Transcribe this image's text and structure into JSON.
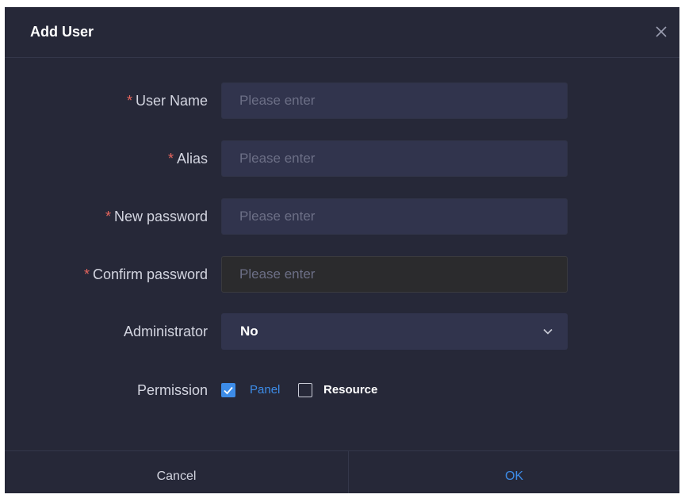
{
  "dialog": {
    "title": "Add User",
    "close_icon": "close-icon"
  },
  "form": {
    "required_mark": "*",
    "username": {
      "label": "User Name",
      "placeholder": "Please enter",
      "value": ""
    },
    "alias": {
      "label": "Alias",
      "placeholder": "Please enter",
      "value": ""
    },
    "new_password": {
      "label": "New password",
      "placeholder": "Please enter",
      "value": ""
    },
    "confirm_password": {
      "label": "Confirm password",
      "placeholder": "Please enter",
      "value": ""
    },
    "administrator": {
      "label": "Administrator",
      "selected": "No",
      "icon": "chevron-down-icon"
    },
    "permission": {
      "label": "Permission",
      "options": [
        {
          "label": "Panel",
          "checked": true
        },
        {
          "label": "Resource",
          "checked": false
        }
      ]
    }
  },
  "footer": {
    "cancel_label": "Cancel",
    "ok_label": "OK"
  },
  "colors": {
    "background": "#262838",
    "input_background": "#31344d",
    "required": "#e8665e",
    "accent": "#3d8ce8"
  }
}
